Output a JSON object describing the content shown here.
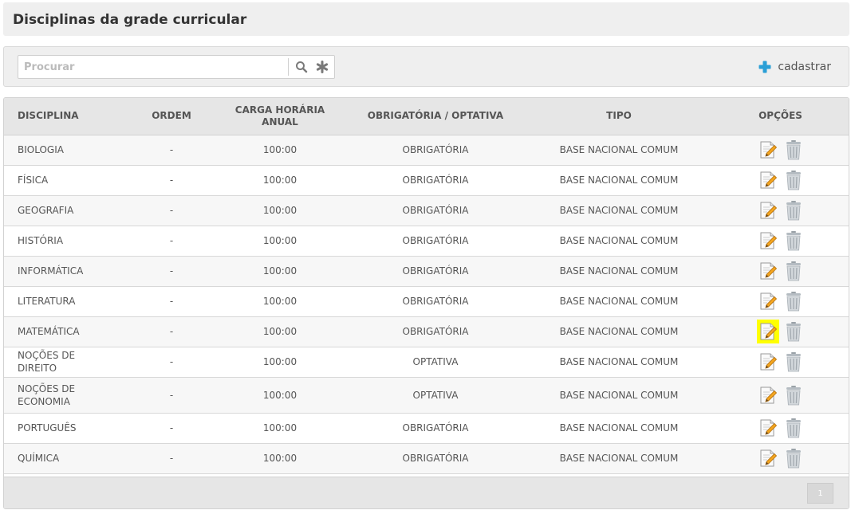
{
  "page": {
    "title": "Disciplinas da grade curricular"
  },
  "search": {
    "placeholder": "Procurar",
    "value": ""
  },
  "actions": {
    "add_label": "cadastrar"
  },
  "table": {
    "columns": [
      "DISCIPLINA",
      "ORDEM",
      "CARGA HORÁRIA ANUAL",
      "OBRIGATÓRIA / OPTATIVA",
      "TIPO",
      "OPÇÕES"
    ],
    "rows": [
      {
        "disciplina": "BIOLOGIA",
        "ordem": "-",
        "carga": "100:00",
        "obrigatoria": "OBRIGATÓRIA",
        "tipo": "BASE NACIONAL COMUM"
      },
      {
        "disciplina": "FÍSICA",
        "ordem": "-",
        "carga": "100:00",
        "obrigatoria": "OBRIGATÓRIA",
        "tipo": "BASE NACIONAL COMUM"
      },
      {
        "disciplina": "GEOGRAFIA",
        "ordem": "-",
        "carga": "100:00",
        "obrigatoria": "OBRIGATÓRIA",
        "tipo": "BASE NACIONAL COMUM"
      },
      {
        "disciplina": "HISTÓRIA",
        "ordem": "-",
        "carga": "100:00",
        "obrigatoria": "OBRIGATÓRIA",
        "tipo": "BASE NACIONAL COMUM"
      },
      {
        "disciplina": "INFORMÁTICA",
        "ordem": "-",
        "carga": "100:00",
        "obrigatoria": "OBRIGATÓRIA",
        "tipo": "BASE NACIONAL COMUM"
      },
      {
        "disciplina": "LITERATURA",
        "ordem": "-",
        "carga": "100:00",
        "obrigatoria": "OBRIGATÓRIA",
        "tipo": "BASE NACIONAL COMUM"
      },
      {
        "disciplina": "MATEMÁTICA",
        "ordem": "-",
        "carga": "100:00",
        "obrigatoria": "OBRIGATÓRIA",
        "tipo": "BASE NACIONAL COMUM",
        "highlight_edit": true
      },
      {
        "disciplina": "NOÇÕES DE DIREITO",
        "ordem": "-",
        "carga": "100:00",
        "obrigatoria": "OPTATIVA",
        "tipo": "BASE NACIONAL COMUM"
      },
      {
        "disciplina": "NOÇÕES DE ECONOMIA",
        "ordem": "-",
        "carga": "100:00",
        "obrigatoria": "OPTATIVA",
        "tipo": "BASE NACIONAL COMUM"
      },
      {
        "disciplina": "PORTUGUÊS",
        "ordem": "-",
        "carga": "100:00",
        "obrigatoria": "OBRIGATÓRIA",
        "tipo": "BASE NACIONAL COMUM"
      },
      {
        "disciplina": "QUÍMICA",
        "ordem": "-",
        "carga": "100:00",
        "obrigatoria": "OBRIGATÓRIA",
        "tipo": "BASE NACIONAL COMUM"
      }
    ]
  },
  "pagination": {
    "current_page": "1"
  },
  "icons": {
    "search": "search-icon",
    "clear": "asterisk-icon",
    "add": "plus-icon",
    "edit": "edit-icon",
    "delete": "trash-icon"
  },
  "colors": {
    "add_icon": "#2a9fd6",
    "highlight": "#ffff00"
  }
}
